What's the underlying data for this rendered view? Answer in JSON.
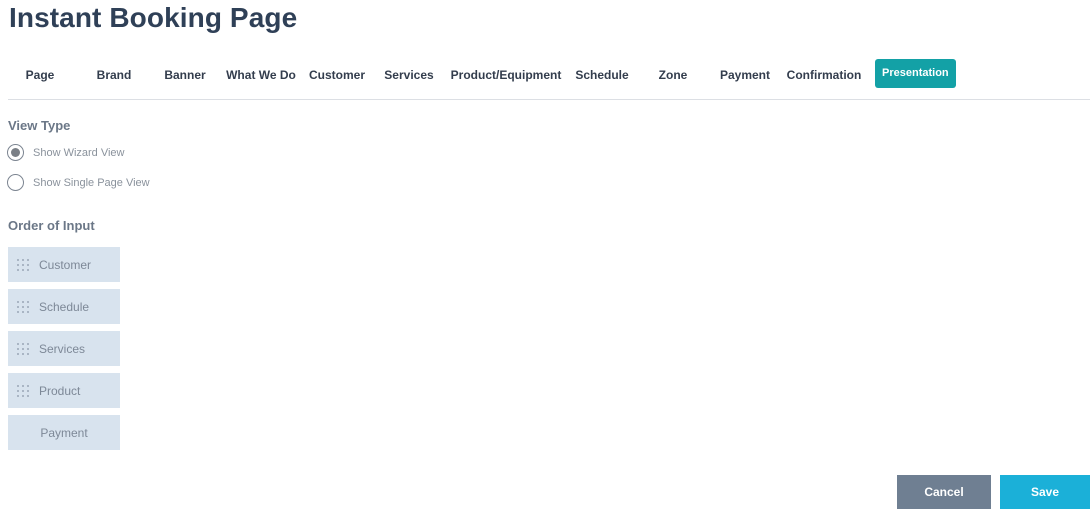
{
  "page": {
    "title": "Instant Booking Page"
  },
  "tabs": [
    {
      "label": "Page",
      "active": false
    },
    {
      "label": "Brand",
      "active": false
    },
    {
      "label": "Banner",
      "active": false
    },
    {
      "label": "What We Do",
      "active": false
    },
    {
      "label": "Customer",
      "active": false
    },
    {
      "label": "Services",
      "active": false
    },
    {
      "label": "Product/Equipment",
      "active": false
    },
    {
      "label": "Schedule",
      "active": false
    },
    {
      "label": "Zone",
      "active": false
    },
    {
      "label": "Payment",
      "active": false
    },
    {
      "label": "Confirmation",
      "active": false
    },
    {
      "label": "Presentation",
      "active": true
    }
  ],
  "view_type": {
    "label": "View Type",
    "options": [
      {
        "label": "Show Wizard View",
        "checked": true
      },
      {
        "label": "Show Single Page View",
        "checked": false
      }
    ]
  },
  "order_of_input": {
    "label": "Order of Input",
    "items": [
      {
        "label": "Customer",
        "draggable": true,
        "icon": "drag-handle-icon"
      },
      {
        "label": "Schedule",
        "draggable": true,
        "icon": "drag-handle-icon"
      },
      {
        "label": "Services",
        "draggable": true,
        "icon": "drag-handle-icon"
      },
      {
        "label": "Product",
        "draggable": true,
        "icon": "drag-handle-icon"
      },
      {
        "label": "Payment",
        "draggable": false
      }
    ]
  },
  "actions": {
    "cancel_label": "Cancel",
    "save_label": "Save"
  },
  "colors": {
    "active_tab": "#13a1a6",
    "order_item_bg": "#d8e3ee",
    "cancel_button": "#6f7f92",
    "save_button": "#1bb0d8",
    "title": "#2f4057"
  }
}
